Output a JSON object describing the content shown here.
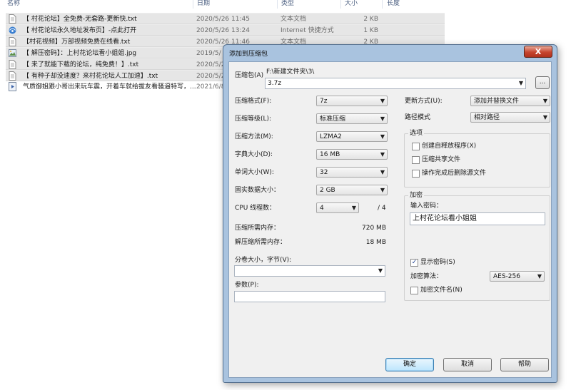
{
  "explorer": {
    "columns": {
      "name": "名称",
      "date": "日期",
      "type": "类型",
      "size": "大小",
      "length": "长度"
    },
    "files": [
      {
        "name": "【 村花论坛】全免费-无套路-更新快.txt",
        "date": "2020/5/26 11:45",
        "type": "文本文档",
        "size": "2 KB",
        "icon": "text-file-icon"
      },
      {
        "name": "【 村花论坛永久地址发布页】-点此打开",
        "date": "2020/5/26 13:24",
        "type": "Internet 快捷方式",
        "size": "1 KB",
        "icon": "internet-shortcut-icon"
      },
      {
        "name": "【村花视频】万部视频免费在线看.txt",
        "date": "2020/5/26 11:46",
        "type": "文本文档",
        "size": "2 KB",
        "icon": "text-file-icon"
      },
      {
        "name": "【 解压密码】：上村花论坛看小姐姐.jpg",
        "date": "2019/5/",
        "type": "",
        "size": "",
        "icon": "image-file-icon"
      },
      {
        "name": "【 来了就能下载的论坛，纯免费！】.txt",
        "date": "2020/5/2",
        "type": "",
        "size": "",
        "icon": "text-file-icon"
      },
      {
        "name": "【 有种子却没速度？来村花论坛人工加速】.txt",
        "date": "2020/5/2",
        "type": "",
        "size": "",
        "icon": "text-file-icon"
      },
      {
        "name": "气质御姐跟小哥出来玩车震，开着车就给拔友看骚逼特写，...",
        "date": "2021/6/8",
        "type": "",
        "size": "",
        "icon": "video-file-icon"
      }
    ]
  },
  "dialog": {
    "title": "添加到压缩包",
    "close_label": "X",
    "archive_label": "压缩包(A)",
    "archive_path": "F:\\新建文件夹\\3\\",
    "archive_name": "3.7z",
    "browse_label": "...",
    "left": {
      "format_label": "压缩格式(F):",
      "format_value": "7z",
      "level_label": "压缩等级(L):",
      "level_value": "标准压缩",
      "method_label": "压缩方法(M):",
      "method_value": "LZMA2",
      "dict_label": "字典大小(D):",
      "dict_value": "16 MB",
      "word_label": "单词大小(W):",
      "word_value": "32",
      "solid_label": "固实数据大小：",
      "solid_value": "2 GB",
      "cpu_label": "CPU 线程数：",
      "cpu_value": "4",
      "cpu_total": "/ 4",
      "mem_comp_label": "压缩所需内存：",
      "mem_comp_value": "720 MB",
      "mem_decomp_label": "解压缩所需内存：",
      "mem_decomp_value": "18 MB",
      "volume_label": "分卷大小，字节(V):",
      "params_label": "参数(P):"
    },
    "right": {
      "update_label": "更新方式(U):",
      "update_value": "添加并替换文件",
      "path_label": "路径模式",
      "path_value": "相对路径",
      "options_title": "选项",
      "opt_sfx": "创建自释放程序(X)",
      "opt_shared": "压缩共享文件",
      "opt_delete": "操作完成后删除源文件",
      "enc_title": "加密",
      "pwd_label": "输入密码：",
      "pwd_value": "上村花论坛看小姐姐",
      "show_pwd": "显示密码(S)",
      "enc_method_label": "加密算法：",
      "enc_method_value": "AES-256",
      "enc_names": "加密文件名(N)"
    },
    "buttons": {
      "ok": "确定",
      "cancel": "取消",
      "help": "帮助"
    }
  }
}
